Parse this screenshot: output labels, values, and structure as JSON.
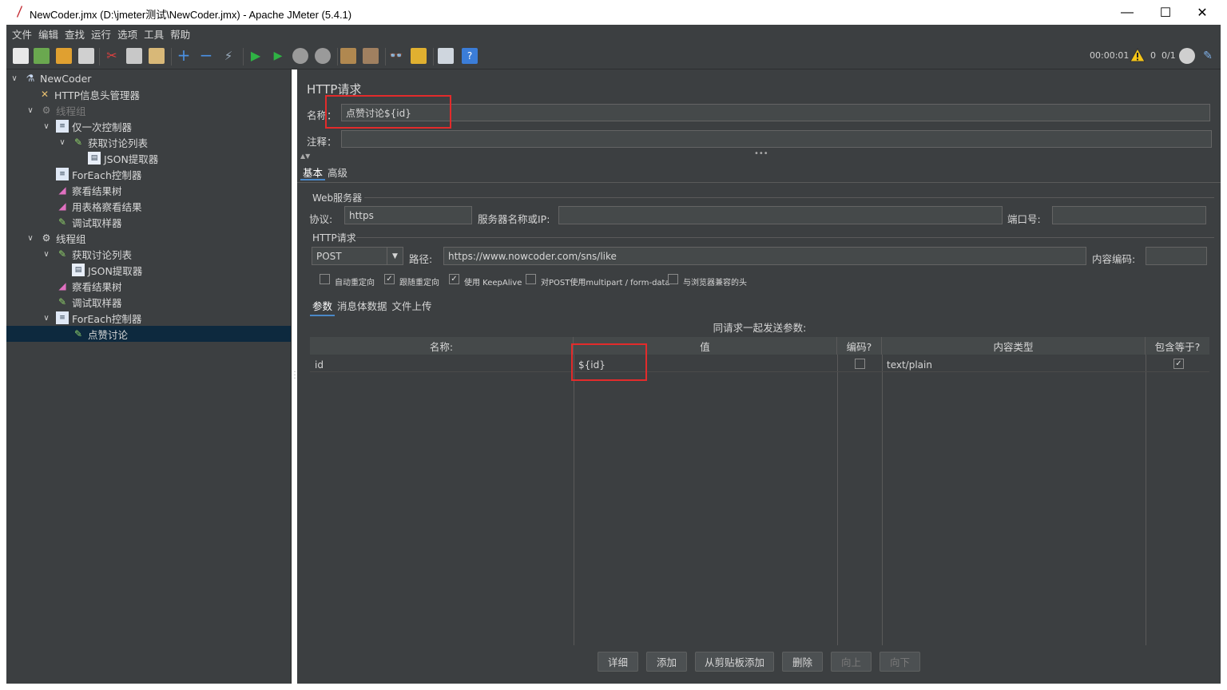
{
  "window": {
    "title": "NewCoder.jmx (D:\\jmeter测试\\NewCoder.jmx) - Apache JMeter (5.4.1)",
    "minimize": "—",
    "maximize": "☐",
    "close": "✕"
  },
  "menu": [
    "文件",
    "编辑",
    "查找",
    "运行",
    "选项",
    "工具",
    "帮助"
  ],
  "toolbar": {
    "elapsed": "00:00:01",
    "warnings": "0",
    "threads": "0/1"
  },
  "tree": [
    {
      "label": "NewCoder",
      "icon": "flask-icon"
    },
    {
      "label": "HTTP信息头管理器",
      "icon": "tools-icon"
    },
    {
      "label": "线程组",
      "icon": "gear-icon"
    },
    {
      "label": "仅一次控制器",
      "icon": "controller-icon"
    },
    {
      "label": "获取讨论列表",
      "icon": "sampler-icon"
    },
    {
      "label": "JSON提取器",
      "icon": "extractor-icon"
    },
    {
      "label": "ForEach控制器",
      "icon": "controller-icon"
    },
    {
      "label": "察看结果树",
      "icon": "listener-icon"
    },
    {
      "label": "用表格察看结果",
      "icon": "listener-icon"
    },
    {
      "label": "调试取样器",
      "icon": "sampler-icon"
    },
    {
      "label": "线程组",
      "icon": "gear-icon"
    },
    {
      "label": "获取讨论列表",
      "icon": "sampler-icon"
    },
    {
      "label": "JSON提取器",
      "icon": "extractor-icon"
    },
    {
      "label": "察看结果树",
      "icon": "listener-icon"
    },
    {
      "label": "调试取样器",
      "icon": "sampler-icon"
    },
    {
      "label": "ForEach控制器",
      "icon": "controller-icon"
    },
    {
      "label": "点赞讨论",
      "icon": "sampler-icon"
    }
  ],
  "panel": {
    "title": "HTTP请求",
    "name_label": "名称：",
    "name_value": "点赞讨论${id}",
    "comment_label": "注释：",
    "comment_value": "",
    "tabs": [
      "基本",
      "高级"
    ],
    "web_server_group": "Web服务器",
    "protocol_label": "协议:",
    "protocol_value": "https",
    "server_label": "服务器名称或IP:",
    "server_value": "",
    "port_label": "端口号:",
    "port_value": "",
    "http_group": "HTTP请求",
    "method_value": "POST",
    "path_label": "路径:",
    "path_value": "https://www.nowcoder.com/sns/like",
    "encoding_label": "内容编码:",
    "encoding_value": "",
    "checkboxes": [
      {
        "label": "自动重定向",
        "checked": false
      },
      {
        "label": "跟随重定向",
        "checked": true
      },
      {
        "label": "使用 KeepAlive",
        "checked": true
      },
      {
        "label": "对POST使用multipart / form-data",
        "checked": false
      },
      {
        "label": "与浏览器兼容的头",
        "checked": false
      }
    ],
    "subtabs": [
      "参数",
      "消息体数据",
      "文件上传"
    ],
    "params_caption": "同请求一起发送参数:",
    "columns": [
      "名称:",
      "值",
      "编码?",
      "内容类型",
      "包含等于?"
    ],
    "rows": [
      {
        "name": "id",
        "value": "${id}",
        "encode": false,
        "content_type": "text/plain",
        "include_equals": true
      }
    ],
    "buttons": [
      {
        "label": "详细",
        "enabled": true
      },
      {
        "label": "添加",
        "enabled": true
      },
      {
        "label": "从剪贴板添加",
        "enabled": true
      },
      {
        "label": "删除",
        "enabled": true
      },
      {
        "label": "向上",
        "enabled": false
      },
      {
        "label": "向下",
        "enabled": false
      }
    ]
  },
  "colors": {
    "background": "#3c3f41",
    "selection": "#0d293e",
    "highlight_box": "#e32b2b",
    "tab_underline": "#4a88c7"
  }
}
